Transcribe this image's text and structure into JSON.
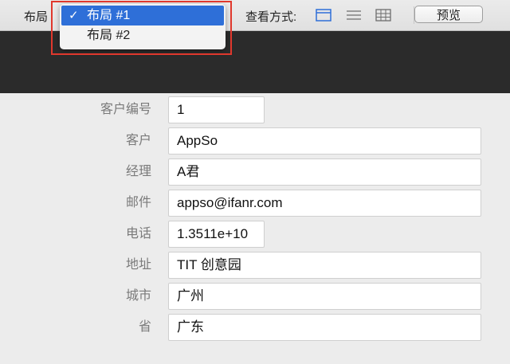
{
  "toolbar": {
    "layout_label": "布局",
    "view_label": "查看方式:",
    "view_modes": [
      "form-view-icon",
      "list-view-icon",
      "table-view-icon"
    ],
    "preview_label": "预览",
    "accent_color": "#2e6fd8"
  },
  "layout_menu": {
    "selected_mark": "✓",
    "items": [
      {
        "label": "布局 #1",
        "selected": true
      },
      {
        "label": "布局 #2",
        "selected": false
      }
    ],
    "highlight_color": "#e0382d"
  },
  "form": {
    "fields": [
      {
        "label": "客户编号",
        "value": "1"
      },
      {
        "label": "客户",
        "value": "AppSo"
      },
      {
        "label": "经理",
        "value": "A君"
      },
      {
        "label": "邮件",
        "value": "appso@ifanr.com"
      },
      {
        "label": "电话",
        "value": "1.3511e+10"
      },
      {
        "label": "地址",
        "value": "TIT 创意园"
      },
      {
        "label": "城市",
        "value": "广州"
      },
      {
        "label": "省",
        "value": "广东"
      }
    ]
  }
}
